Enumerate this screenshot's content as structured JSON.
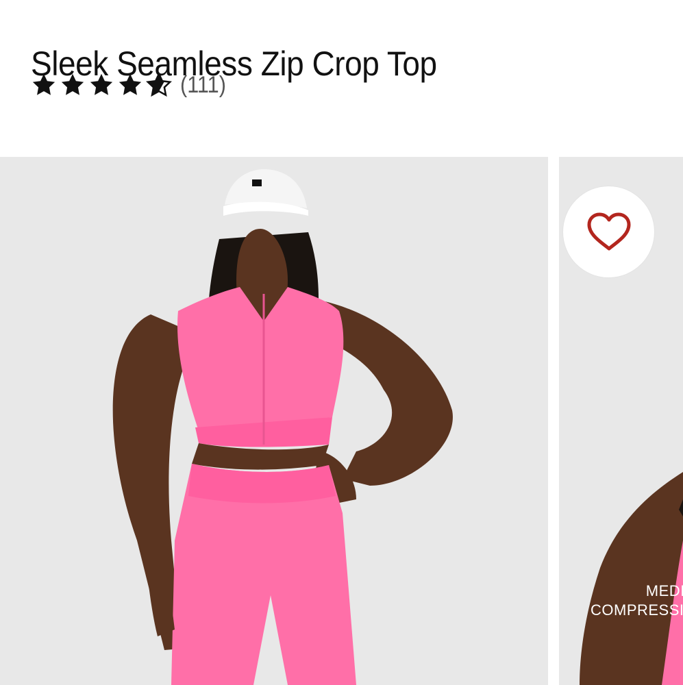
{
  "product": {
    "title": "Sleek Seamless Zip Crop Top",
    "rating": {
      "stars": 4.5,
      "max_stars": 5,
      "review_count": "(111)"
    }
  },
  "gallery": {
    "slide_2_badge": {
      "line1": "MEDIU",
      "line2": "COMPRESSIO"
    }
  },
  "icons": {
    "star": "star-icon",
    "favorite": "heart-icon"
  },
  "colors": {
    "star": "#111111",
    "heart": "#b3261e",
    "product_pink": "#ff6fa8",
    "photo_background": "#e8e8e8"
  }
}
